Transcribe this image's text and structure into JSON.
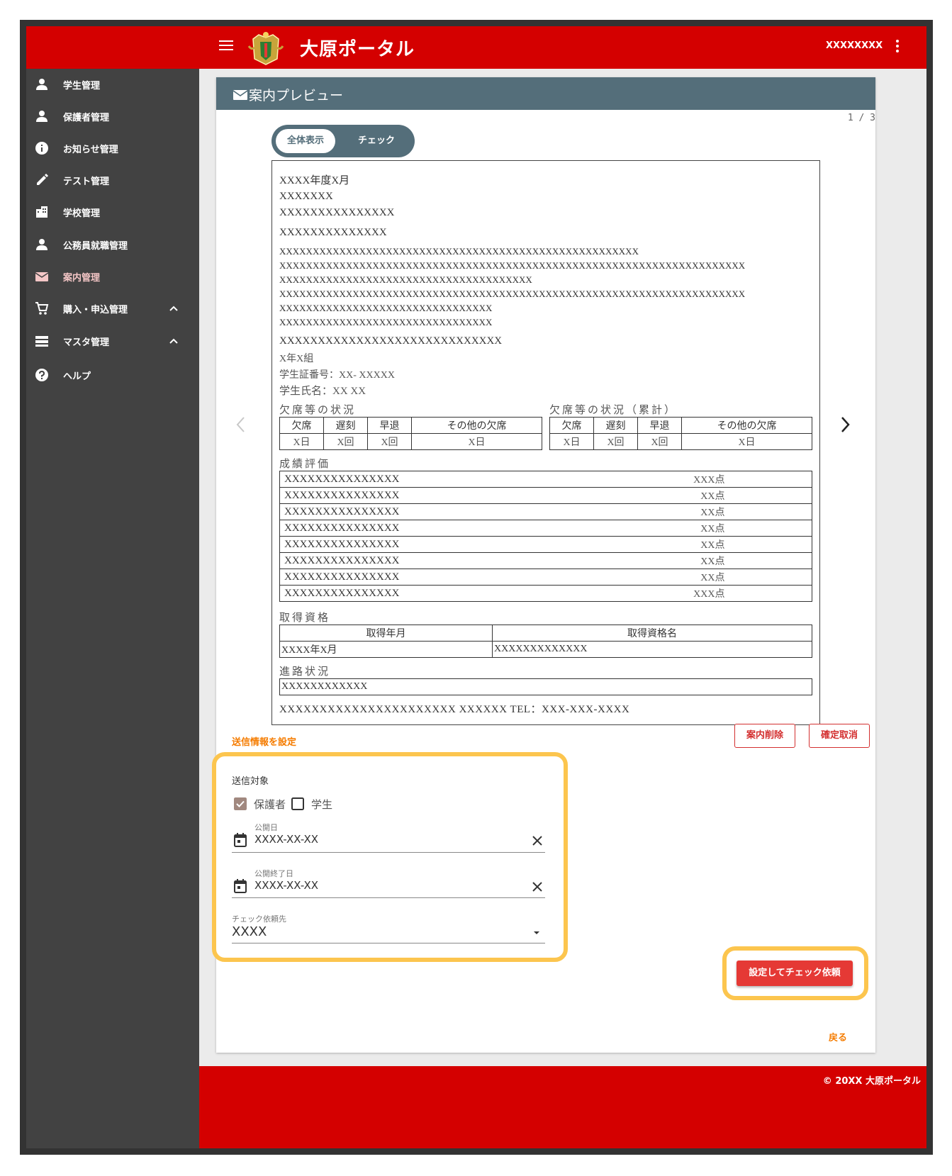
{
  "header": {
    "title": "大原ポータル",
    "user": "XXXXXXXX"
  },
  "sidebar": {
    "items": [
      {
        "label": "学生管理",
        "icon": "person-icon"
      },
      {
        "label": "保護者管理",
        "icon": "person-icon"
      },
      {
        "label": "お知らせ管理",
        "icon": "info-icon"
      },
      {
        "label": "テスト管理",
        "icon": "pencil-icon"
      },
      {
        "label": "学校管理",
        "icon": "building-icon"
      },
      {
        "label": "公務員就職管理",
        "icon": "person-icon"
      },
      {
        "label": "案内管理",
        "icon": "mail-icon",
        "active": true
      },
      {
        "label": "購入・申込管理",
        "icon": "cart-icon",
        "expandable": true
      },
      {
        "label": "マスタ管理",
        "icon": "list-icon",
        "expandable": true
      },
      {
        "label": "ヘルプ",
        "icon": "help-icon"
      }
    ]
  },
  "card": {
    "title": "案内プレビュー",
    "pager": "1 / 3",
    "toggle": {
      "all": "全体表示",
      "check": "チェック"
    }
  },
  "doc": {
    "lines": {
      "date": "XXXX年度X月",
      "to1": "XXXXXXX",
      "to2": "XXXXXXXXXXXXXXX",
      "from": "XXXXXXXXXXXXXX",
      "b1": "XXXXXXXXXXXXXXXXXXXXXXXXXXXXXXXXXXXXXXXXXXXXXXXXXXXXXX",
      "b2": "XXXXXXXXXXXXXXXXXXXXXXXXXXXXXXXXXXXXXXXXXXXXXXXXXXXXXXXXXXXXXXXXXXXXXX",
      "b3": "XXXXXXXXXXXXXXXXXXXXXXXXXXXXXXXXXXXXXX",
      "b4": "XXXXXXXXXXXXXXXXXXXXXXXXXXXXXXXXXXXXXXXXXXXXXXXXXXXXXXXXXXXXXXXXXXXXXX",
      "b5": "XXXXXXXXXXXXXXXXXXXXXXXXXXXXXXXX",
      "b6": "XXXXXXXXXXXXXXXXXXXXXXXXXXXXXXXX",
      "heading": "XXXXXXXXXXXXXXXXXXXXXXXXXXXXX",
      "class": "X年X組",
      "student_no": "学生証番号：XX- XXXXX",
      "student_name": "学生氏名：XX XX",
      "footer": "XXXXXXXXXXXXXXXXXXXXXX XXXXXX TEL：XXX-XXX-XXXX"
    },
    "attendance": {
      "title": "欠席等の状況",
      "title_total": "欠席等の状況（累計）",
      "headers": [
        "欠席",
        "遅刻",
        "早退",
        "その他の欠席"
      ],
      "values": [
        "X日",
        "X回",
        "X回",
        "X日"
      ],
      "values_total": [
        "X日",
        "X回",
        "X回",
        "X日"
      ]
    },
    "grades": {
      "title": "成績評価",
      "rows": [
        {
          "subject": "XXXXXXXXXXXXXXX",
          "score": "XXX点"
        },
        {
          "subject": "XXXXXXXXXXXXXXX",
          "score": "XX点"
        },
        {
          "subject": "XXXXXXXXXXXXXXX",
          "score": "XX点"
        },
        {
          "subject": "XXXXXXXXXXXXXXX",
          "score": "XX点"
        },
        {
          "subject": "XXXXXXXXXXXXXXX",
          "score": "XX点"
        },
        {
          "subject": "XXXXXXXXXXXXXXX",
          "score": "XX点"
        },
        {
          "subject": "XXXXXXXXXXXXXXX",
          "score": "XX点"
        },
        {
          "subject": "XXXXXXXXXXXXXXX",
          "score": "XXX点"
        }
      ]
    },
    "qualifications": {
      "title": "取得資格",
      "headers": [
        "取得年月",
        "取得資格名"
      ],
      "row": [
        "XXXX年X月",
        "XXXXXXXXXXXXX"
      ]
    },
    "career": {
      "title": "進路状況",
      "value": "XXXXXXXXXXXX"
    }
  },
  "actions": {
    "send_settings": "送信情報を設定",
    "delete": "案内削除",
    "cancel_confirm": "確定取消",
    "submit": "設定してチェック依頼",
    "back": "戻る"
  },
  "form": {
    "send_target": "送信対象",
    "guardian": "保護者",
    "guardian_checked": true,
    "student": "学生",
    "student_checked": false,
    "publish_date_label": "公開日",
    "publish_date": "XXXX-XX-XX",
    "end_date_label": "公開終了日",
    "end_date": "XXXX-XX-XX",
    "checker_label": "チェック依頼先",
    "checker": "XXXX"
  },
  "footer": {
    "copyright": "© 20XX 大原ポータル"
  },
  "colors": {
    "header": "#d40000",
    "sidebar": "#424242",
    "card_head": "#546e7a",
    "highlight": "#fcc54e",
    "accent": "#f57c00",
    "danger": "#e53935"
  }
}
